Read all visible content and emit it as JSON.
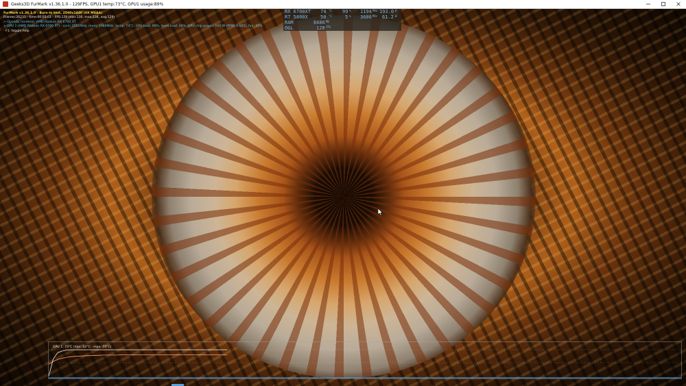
{
  "window": {
    "title": "Geeks3D FurMark v1.36.1.0 - 129FPS, GPU1 temp:73°C, GPU1 usage:89%",
    "minimize_icon": "minimize-icon",
    "maximize_icon": "maximize-icon",
    "close_icon": "close-icon"
  },
  "hud": {
    "line1": "FurMark v1.36.1.0 - Burn-in test, 2560x1440 (0X MSAA)",
    "line2": "Frames:26231 - time:00:03:01 - FPS:129 (min:130, max:134, avg:129)",
    "line3": "> OpenGL renderer: AMD Radeon RX 6700 XT",
    "line4": "> GPU 1 (AMD Radeon RX 6700 XT) - core: 2565MHz, mem: 1988MHz, temp: 74°C, GPU load: 99%, mem load: 48%, GPU chip power: 194 W (PPW: 0.665), fan: 31%",
    "line5": "- F1: toggle help"
  },
  "osd": {
    "rows": [
      {
        "label": "RX 6700XT",
        "v1": "74",
        "u1": "°C",
        "v2": "99",
        "u2": "%",
        "v3": "1194",
        "u3": "MHz",
        "v4": "193.0",
        "u4": "W"
      },
      {
        "label": "R7 5800X",
        "v1": "50",
        "u1": "°C",
        "v2": "5",
        "u2": "%",
        "v3": "3600",
        "u3": "MHz",
        "v4": "61.2",
        "u4": "W"
      },
      {
        "label": "RAM",
        "v1": "6686",
        "u1": "MB"
      },
      {
        "label": "OGL",
        "v1": "128",
        "u1": "FPS"
      }
    ]
  },
  "graph": {
    "title": "GPU 1: 73°C (min: 43°C - max: 74°C)",
    "series": [
      {
        "name": "GPU 1 temp",
        "color": "#ff9a7a",
        "values": [
          43,
          52,
          58,
          62,
          65,
          67,
          68,
          69,
          70,
          70,
          71,
          71,
          72,
          72,
          72,
          72,
          73,
          73,
          73,
          73,
          73,
          73,
          73,
          73,
          73,
          73,
          73,
          73,
          73,
          73,
          73,
          73,
          73,
          73,
          73,
          73,
          73,
          73,
          73,
          73
        ]
      },
      {
        "name": "GPU 1 usage",
        "color": "#f0f0f0",
        "values": [
          5,
          60,
          80,
          85,
          88,
          89,
          89,
          89,
          89,
          89,
          89,
          89,
          89,
          89,
          89,
          89,
          89,
          89,
          89,
          89,
          89,
          89,
          89,
          89,
          89,
          89,
          89,
          89,
          89,
          89,
          89,
          89,
          89,
          89,
          89,
          89,
          89,
          89,
          89,
          89
        ]
      }
    ]
  }
}
